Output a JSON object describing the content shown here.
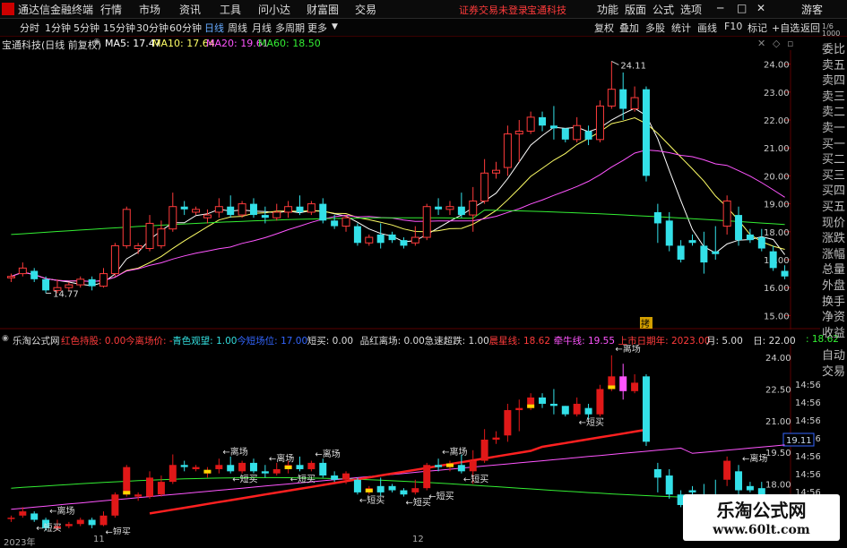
{
  "menu": {
    "app_title": "通达信金融终端",
    "items": [
      "行情",
      "市场",
      "资讯",
      "工具",
      "问小达",
      "财富圈",
      "交易"
    ],
    "status": "证券交易未登录",
    "stock_tag": "宝通科技",
    "right_items": [
      "功能",
      "版面",
      "公式",
      "选项"
    ],
    "guest": "游客"
  },
  "toolbar": {
    "periods": [
      "分时",
      "1分钟",
      "5分钟",
      "15分钟",
      "30分钟",
      "60分钟",
      "日线",
      "周线",
      "月线",
      "多周期",
      "更多"
    ],
    "active_period": "日线",
    "right_buttons": [
      "复权",
      "叠加",
      "多股",
      "统计",
      "画线",
      "F10",
      "标记",
      "+自选",
      "返回"
    ]
  },
  "info": {
    "stock_name": "宝通科技(日线 前复权)",
    "ma5": "MA5: 17.47",
    "ma10": "MA10: 17.64",
    "ma20": "MA20: 19.61",
    "ma60": "MA60: 18.50",
    "colors": {
      "ma5": "#ffffff",
      "ma10": "#ffff66",
      "ma20": "#ff55ff",
      "ma60": "#33ee33"
    }
  },
  "sidebar": [
    "委比",
    "卖五",
    "卖四",
    "卖三",
    "卖二",
    "卖一",
    "买一",
    "买二",
    "买三",
    "买四",
    "买五",
    "现价",
    "涨跌",
    "涨幅",
    "总量",
    "外盘",
    "换手",
    "净资",
    "收益"
  ],
  "sidebar_lower": [
    "自动",
    "交易"
  ],
  "sidebar_top_small": [
    "1/6",
    "1000"
  ],
  "main_axis": {
    "ticks": [
      "24.00",
      "23.00",
      "22.00",
      "21.00",
      "20.00",
      "19.00",
      "18.00",
      "17.00",
      "16.00",
      "15.00"
    ],
    "high_label": "24.11",
    "low_label": "14.77",
    "event_tag": "拷"
  },
  "indicator": {
    "title": "乐淘公式网",
    "items": [
      {
        "text": "红色持股: 0.00",
        "color": "#ff3b3b"
      },
      {
        "text": "今离场价: -",
        "color": "#ff3b3b"
      },
      {
        "text": "青色观望: 1.00",
        "color": "#33dddd"
      },
      {
        "text": "今短场位: 17.00",
        "color": "#3366ff"
      },
      {
        "text": "短买: 0.00",
        "color": "#dddddd"
      },
      {
        "text": "品红离场: 0.00",
        "color": "#dddddd"
      },
      {
        "text": "急速超跌: 1.00",
        "color": "#dddddd"
      },
      {
        "text": "晨星线: 18.62",
        "color": "#ff3b3b"
      },
      {
        "text": "牵牛线: 19.55",
        "color": "#ff55ff"
      },
      {
        "text": "上市日期年: 2023.00",
        "color": "#ff3b3b"
      },
      {
        "text": "月: 5.00",
        "color": "#dddddd"
      },
      {
        "text": "日: 22.00",
        "color": "#dddddd"
      },
      {
        "text": ": 18.62",
        "color": "#33ee33"
      },
      {
        "text": ": 19.55",
        "color": "#dddddd"
      }
    ],
    "axis_ticks": [
      "24.00",
      "22.50",
      "21.00",
      "19.50",
      "18.00"
    ],
    "axis_right": [
      "14:56",
      "14:56",
      "14:56",
      "14:56",
      "14:56",
      "14:56",
      "14:56",
      "14:56"
    ],
    "current_value": "19.11",
    "labels": {
      "exit": "离场",
      "buy": "短买"
    }
  },
  "bottom_axis": {
    "labels": [
      "2023年",
      "11",
      "12"
    ]
  },
  "watermark": {
    "line1": "乐淘公式网",
    "line2": "www.60lt.com"
  },
  "chart_data": {
    "type": "candlestick",
    "ylim": [
      14.5,
      24.5
    ],
    "candles": [
      [
        16.35,
        16.4,
        16.2,
        16.5
      ],
      [
        16.5,
        16.7,
        16.4,
        16.9
      ],
      [
        16.6,
        16.3,
        16.2,
        16.7
      ],
      [
        16.3,
        15.9,
        15.8,
        16.4
      ],
      [
        15.9,
        16.0,
        15.8,
        16.3
      ],
      [
        16.0,
        16.1,
        15.9,
        16.2
      ],
      [
        16.1,
        16.3,
        16.0,
        16.4
      ],
      [
        16.3,
        16.05,
        15.9,
        16.4
      ],
      [
        16.05,
        16.5,
        16.0,
        16.7
      ],
      [
        16.5,
        17.5,
        16.4,
        17.6
      ],
      [
        17.5,
        18.8,
        17.4,
        18.9
      ],
      [
        17.4,
        17.5,
        17.2,
        17.6
      ],
      [
        17.4,
        18.3,
        17.3,
        18.6
      ],
      [
        17.5,
        18.1,
        17.4,
        18.4
      ],
      [
        18.1,
        18.9,
        18.0,
        19.4
      ],
      [
        18.9,
        18.8,
        18.6,
        19.1
      ],
      [
        18.7,
        18.8,
        18.6,
        18.9
      ],
      [
        18.5,
        18.6,
        18.3,
        18.8
      ],
      [
        18.7,
        18.9,
        18.5,
        19.2
      ],
      [
        18.9,
        18.6,
        18.5,
        19.3
      ],
      [
        18.6,
        19.0,
        18.5,
        19.1
      ],
      [
        19.0,
        18.6,
        18.5,
        19.2
      ],
      [
        18.6,
        18.5,
        18.3,
        18.9
      ],
      [
        18.5,
        18.7,
        18.4,
        19.0
      ],
      [
        18.7,
        18.9,
        18.5,
        19.1
      ],
      [
        18.9,
        18.7,
        18.6,
        19.3
      ],
      [
        18.7,
        19.0,
        18.6,
        19.1
      ],
      [
        19.0,
        18.4,
        18.3,
        19.2
      ],
      [
        18.4,
        18.2,
        18.1,
        18.6
      ],
      [
        18.2,
        18.5,
        18.0,
        18.6
      ],
      [
        18.2,
        17.6,
        17.5,
        18.3
      ],
      [
        17.6,
        17.8,
        17.5,
        17.9
      ],
      [
        17.9,
        17.6,
        17.4,
        18.3
      ],
      [
        17.9,
        17.7,
        17.6,
        18.0
      ],
      [
        17.7,
        17.5,
        17.4,
        17.8
      ],
      [
        17.6,
        17.8,
        17.5,
        18.2
      ],
      [
        17.8,
        18.9,
        17.7,
        19.0
      ],
      [
        18.9,
        18.8,
        18.6,
        19.2
      ],
      [
        18.8,
        18.9,
        18.6,
        19.1
      ],
      [
        18.9,
        18.6,
        18.5,
        19.4
      ],
      [
        18.6,
        19.1,
        18.0,
        19.6
      ],
      [
        19.1,
        20.1,
        19.0,
        20.6
      ],
      [
        20.1,
        20.2,
        19.9,
        20.5
      ],
      [
        20.3,
        21.5,
        20.0,
        21.8
      ],
      [
        21.5,
        21.6,
        20.5,
        22.0
      ],
      [
        21.6,
        22.1,
        21.5,
        22.3
      ],
      [
        22.1,
        21.8,
        21.6,
        22.3
      ],
      [
        21.8,
        21.7,
        21.3,
        22.5
      ],
      [
        21.7,
        21.3,
        21.2,
        21.7
      ],
      [
        21.3,
        21.8,
        21.2,
        22.1
      ],
      [
        21.6,
        21.3,
        21.1,
        21.8
      ],
      [
        21.3,
        22.5,
        21.2,
        22.7
      ],
      [
        22.5,
        23.1,
        22.4,
        24.1
      ],
      [
        23.1,
        22.4,
        22.0,
        23.7
      ],
      [
        22.4,
        22.8,
        22.3,
        23.2
      ],
      [
        23.1,
        20.0,
        19.8,
        23.2
      ],
      [
        18.7,
        18.3,
        17.6,
        19.0
      ],
      [
        18.4,
        17.5,
        17.3,
        18.7
      ],
      [
        17.5,
        17.0,
        16.9,
        17.7
      ],
      [
        17.7,
        17.6,
        17.5,
        17.9
      ],
      [
        17.5,
        16.9,
        16.5,
        18.0
      ],
      [
        17.3,
        17.2,
        17.0,
        18.2
      ],
      [
        18.2,
        19.1,
        17.9,
        19.3
      ],
      [
        18.6,
        17.7,
        17.5,
        18.9
      ],
      [
        17.9,
        17.7,
        17.6,
        18.1
      ],
      [
        17.8,
        17.4,
        17.3,
        18.1
      ],
      [
        17.3,
        16.7,
        16.6,
        17.5
      ],
      [
        16.6,
        16.4,
        16.3,
        16.8
      ]
    ],
    "ma5_last": 17.47,
    "ma10_last": 17.64,
    "ma20_last": 19.61,
    "ma60_last": 18.5
  }
}
